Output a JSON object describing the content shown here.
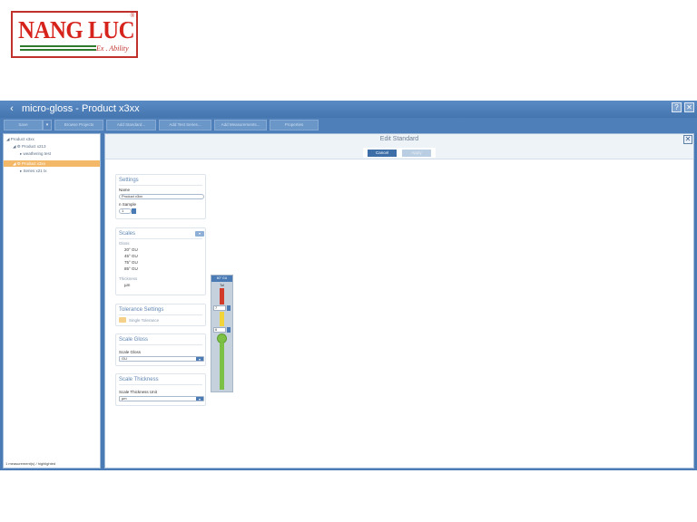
{
  "logo": {
    "main": "NANG LUC",
    "registered": "®",
    "tagline": "Ex . Ability"
  },
  "window": {
    "title": "micro-gloss - Product x3xx",
    "back_glyph": "‹",
    "help_label": "?",
    "close_label": "✕"
  },
  "toolbar": {
    "buttons": [
      "Save",
      "Browse Projects",
      "Add Standard...",
      "Add Test Series...",
      "Add Measurements...",
      "Properties"
    ],
    "dropdown_glyph": "▾"
  },
  "tree": {
    "items": [
      "Product x3xx",
      "Product x213",
      "weathering test",
      "Product x3xx",
      "Series x21 tx"
    ],
    "selected_index": 3,
    "footer": "1 measurement(s) / highlighted"
  },
  "edit_standard": {
    "title": "Edit Standard",
    "close_label": "✕",
    "cancel_label": "Cancel",
    "apply_label": "Apply"
  },
  "settings": {
    "title": "Settings",
    "name_label": "Name",
    "name_value": "Product x3xx",
    "n_sample_label": "n Sample",
    "n_sample_value": "1"
  },
  "scales": {
    "title": "Scales",
    "gloss_label": "Gloss",
    "gloss_items": [
      "20° GU",
      "45° GU",
      "75° GU",
      "85° GU"
    ],
    "thickness_label": "Thickness",
    "thickness_unit": "µm"
  },
  "tolerance_settings": {
    "title": "Tolerance Settings",
    "option_label": "Single Tolerance"
  },
  "scale_gloss": {
    "title": "Scale Gloss",
    "field_label": "Scale Gloss",
    "value": "GU"
  },
  "scale_thickness": {
    "title": "Scale Thickness",
    "field_label": "Scale Thickness Unit",
    "value": "µm"
  },
  "tolerance_widget": {
    "header": "60° GU",
    "tol_label": "Tol",
    "upper_value": "7",
    "lower_value": "6"
  },
  "colors": {
    "window_blue": "#4a7bb5",
    "selected_orange": "#f3b969",
    "tol_red": "#d23a2a",
    "tol_yellow": "#f0d43a",
    "tol_green": "#7cc045"
  }
}
